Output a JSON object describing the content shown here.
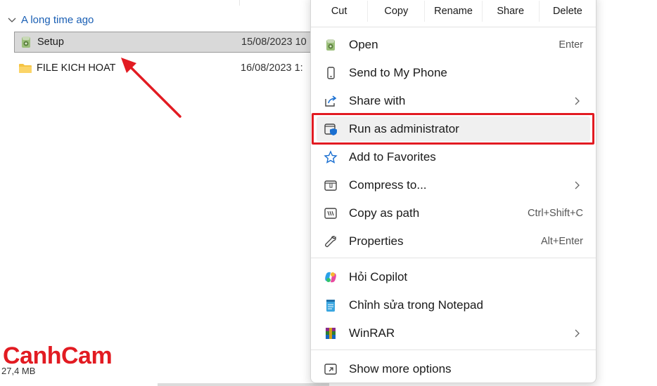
{
  "explorer": {
    "group_label": "A long time ago",
    "files": [
      {
        "name": "Setup",
        "date": "15/08/2023 10"
      },
      {
        "name": "FILE KICH HOAT",
        "date": "16/08/2023 1:"
      }
    ],
    "size_label": "27,4 MB",
    "logo_text": "CanhCam"
  },
  "context_menu": {
    "toolbar": [
      "Cut",
      "Copy",
      "Rename",
      "Share",
      "Delete"
    ],
    "items": [
      {
        "label": "Open",
        "shortcut": "Enter",
        "icon": "setup-app-icon"
      },
      {
        "label": "Send to My Phone",
        "shortcut": "",
        "icon": "phone-icon"
      },
      {
        "label": "Share with",
        "shortcut": "",
        "icon": "share-icon",
        "submenu": true
      },
      {
        "label": "Run as administrator",
        "shortcut": "",
        "icon": "shield-window-icon"
      },
      {
        "label": "Add to Favorites",
        "shortcut": "",
        "icon": "star-icon"
      },
      {
        "label": "Compress to...",
        "shortcut": "",
        "icon": "zip-folder-icon",
        "submenu": true
      },
      {
        "label": "Copy as path",
        "shortcut": "Ctrl+Shift+C",
        "icon": "path-icon"
      },
      {
        "label": "Properties",
        "shortcut": "Alt+Enter",
        "icon": "wrench-icon"
      },
      {
        "label": "Hỏi Copilot",
        "shortcut": "",
        "icon": "copilot-icon"
      },
      {
        "label": "Chỉnh sửa trong Notepad",
        "shortcut": "",
        "icon": "notepad-icon"
      },
      {
        "label": "WinRAR",
        "shortcut": "",
        "icon": "winrar-icon",
        "submenu": true
      },
      {
        "label": "Show more options",
        "shortcut": "",
        "icon": "more-options-icon"
      }
    ]
  },
  "colors": {
    "accent": "#e21b22",
    "link": "#1a5fb4",
    "selection": "#d9d9d9"
  }
}
